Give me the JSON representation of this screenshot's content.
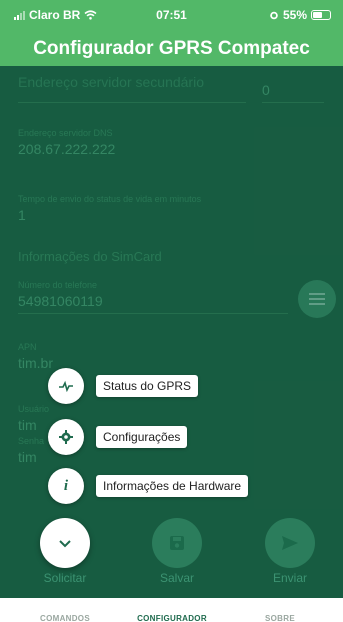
{
  "status_bar": {
    "carrier": "Claro BR",
    "time": "07:51",
    "battery": "55%"
  },
  "app_title": "Configurador GPRS Compatec",
  "form": {
    "top_field_label": "Endereço servidor secundário",
    "top_right_value": "0",
    "dns": {
      "label": "Endereço servidor DNS",
      "value": "208.67.222.222"
    },
    "status_time": {
      "label": "Tempo de envio do status de vida em minutos",
      "value": "1"
    },
    "section_title": "Informações do SimCard",
    "phone": {
      "label": "Número do telefone",
      "value": "54981060119"
    },
    "apn": {
      "label": "APN",
      "value": "tim.br"
    },
    "user": {
      "label": "Usuário",
      "value": "tim"
    },
    "password": {
      "label": "Senha",
      "value": "tim"
    }
  },
  "speed_dial": {
    "items": [
      {
        "label": "Status do GPRS",
        "icon": "pulse-icon"
      },
      {
        "label": "Configurações",
        "icon": "gear-icon"
      },
      {
        "label": "Informações de Hardware",
        "icon": "info-icon"
      }
    ]
  },
  "actions": {
    "request": "Solicitar",
    "save": "Salvar",
    "send": "Enviar"
  },
  "bottom_nav": {
    "tabs": [
      "COMANDOS",
      "CONFIGURADOR",
      "SOBRE"
    ],
    "active": "CONFIGURADOR"
  },
  "colors": {
    "header": "#52b868",
    "content": "#1b6a4b",
    "accent": "#1f6b4e"
  }
}
